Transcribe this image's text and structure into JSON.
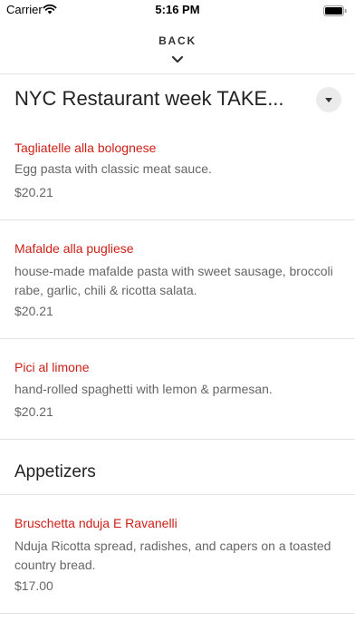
{
  "status_bar": {
    "carrier": "Carrier",
    "time": "5:16 PM"
  },
  "nav": {
    "back_label": "BACK"
  },
  "menu": {
    "title": "NYC Restaurant week TAKE...",
    "sections": [
      {
        "heading": "",
        "items": [
          {
            "name": "Tagliatelle alla bolognese",
            "description": "Egg pasta with classic meat sauce.",
            "price": "$20.21"
          },
          {
            "name": "Mafalde alla pugliese",
            "description": "house-made mafalde pasta with sweet sausage, broccoli rabe, garlic, chili & ricotta salata.",
            "price": "$20.21"
          },
          {
            "name": "Pici al limone",
            "description": "hand-rolled spaghetti with lemon & parmesan.",
            "price": "$20.21"
          }
        ]
      },
      {
        "heading": "Appetizers",
        "items": [
          {
            "name": "Bruschetta nduja E Ravanelli",
            "description": "Nduja Ricotta spread, radishes, and capers on a toasted country bread.",
            "price": "$17.00"
          }
        ]
      }
    ]
  },
  "colors": {
    "accent": "#cc1f16",
    "text_dark": "#222222",
    "text_muted": "#666666",
    "divider": "#e3e3e3"
  }
}
